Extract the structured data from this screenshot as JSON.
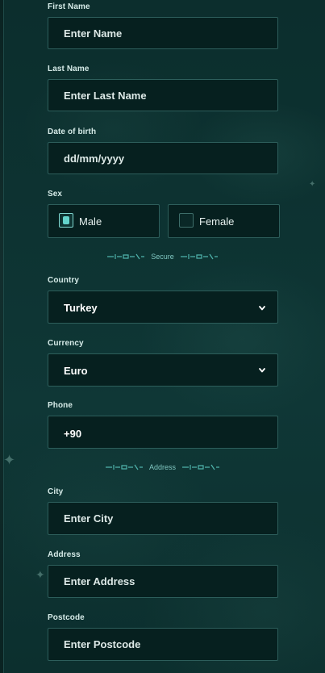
{
  "form": {
    "first_name": {
      "label": "First Name",
      "placeholder": "Enter Name"
    },
    "last_name": {
      "label": "Last Name",
      "placeholder": "Enter Last Name"
    },
    "dob": {
      "label": "Date of birth",
      "placeholder": "dd/mm/yyyy"
    },
    "sex": {
      "label": "Sex",
      "options": [
        {
          "label": "Male",
          "selected": true
        },
        {
          "label": "Female",
          "selected": false
        }
      ]
    },
    "secure_divider": "Secure",
    "country": {
      "label": "Country",
      "value": "Turkey"
    },
    "currency": {
      "label": "Currency",
      "value": "Euro"
    },
    "phone": {
      "label": "Phone",
      "value": "+90"
    },
    "address_divider": "Address",
    "city": {
      "label": "City",
      "placeholder": "Enter City"
    },
    "address": {
      "label": "Address",
      "placeholder": "Enter Address"
    },
    "postcode": {
      "label": "Postcode",
      "placeholder": "Enter Postcode"
    }
  },
  "colors": {
    "background": "#0c2f2e",
    "field_bg": "#06201f",
    "field_border": "#2d5e5b",
    "accent": "#63d3cb"
  },
  "icons": [
    "chevron-down-icon",
    "checkbox-icon",
    "ornament-icon",
    "sparkle-icon"
  ]
}
